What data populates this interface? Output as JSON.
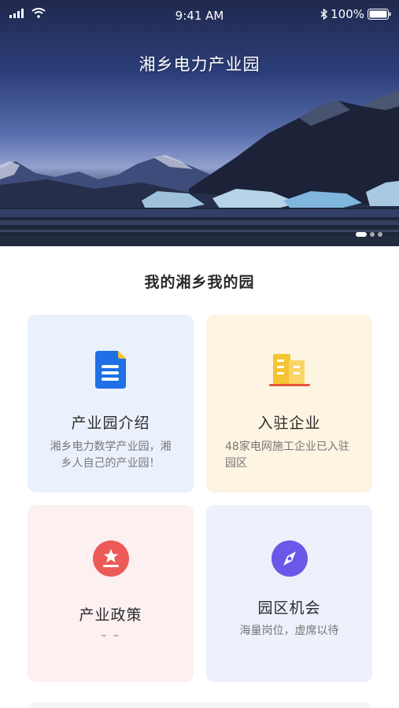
{
  "status_bar": {
    "time": "9:41 AM",
    "battery": "100%",
    "icons": [
      "signal-icon",
      "wifi-icon",
      "bluetooth-icon",
      "battery-icon"
    ]
  },
  "hero": {
    "title": "湘乡电力产业园",
    "carousel_pages": 3,
    "carousel_active": 1
  },
  "section": {
    "title": "我的湘乡我的园"
  },
  "cards": {
    "intro": {
      "title": "产业园介绍",
      "desc": "湘乡电力数学产业园，湘乡人自己的产业园！",
      "icon": "document-icon",
      "color": "#1f6fe6"
    },
    "enterprises": {
      "title": "入驻企业",
      "desc": "48家电网施工企业已入驻园区",
      "icon": "buildings-icon",
      "color": "#f4c431"
    },
    "policy": {
      "title": "产业政策",
      "desc": "– –",
      "icon": "star-badge-icon",
      "color": "#ec5b58"
    },
    "opportunity": {
      "title": "园区机会",
      "desc": "海量岗位，虚席以待",
      "icon": "compass-icon",
      "color": "#6b57e8"
    }
  }
}
